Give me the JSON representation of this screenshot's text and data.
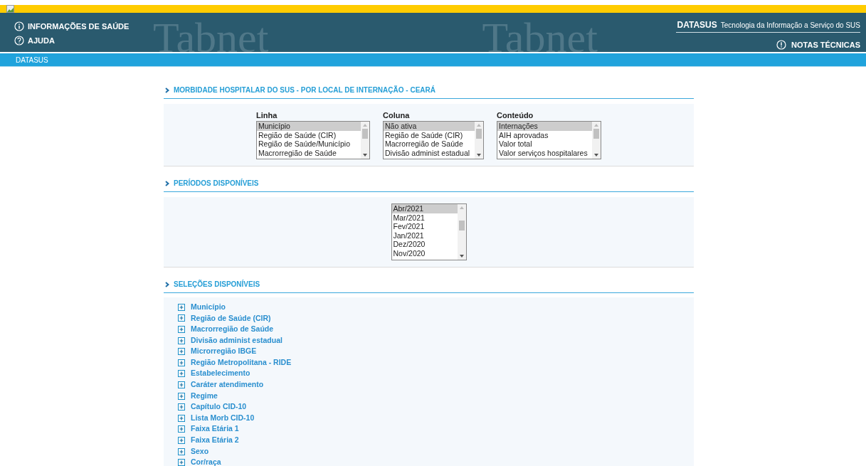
{
  "header": {
    "menu": [
      {
        "kind": "info",
        "label": "INFORMAÇÕES DE SAÚDE"
      },
      {
        "kind": "help",
        "label": "AJUDA"
      }
    ],
    "banner_words": [
      "Tabnet",
      "Tabnet"
    ],
    "brand": "DATASUS",
    "tagline": "Tecnologia da Informação a Serviço do SUS",
    "notes_link": "NOTAS TÉCNICAS"
  },
  "breadcrumb": "DATASUS",
  "sections": [
    {
      "title": "MORBIDADE HOSPITALAR DO SUS - POR LOCAL DE INTERNAÇÃO - CEARÁ",
      "kind": "lists",
      "lists": [
        {
          "label": "Linha",
          "options": [
            {
              "text": "Município",
              "selected": true
            },
            {
              "text": "Região de Saúde (CIR)",
              "selected": false
            },
            {
              "text": "Região de Saúde/Município",
              "selected": false
            },
            {
              "text": "Macrorregião de Saúde",
              "selected": false
            }
          ]
        },
        {
          "label": "Coluna",
          "options": [
            {
              "text": "Não ativa",
              "selected": true
            },
            {
              "text": "Região de Saúde (CIR)",
              "selected": false
            },
            {
              "text": "Macrorregião de Saúde",
              "selected": false
            },
            {
              "text": "Divisão administ estadual",
              "selected": false
            }
          ]
        },
        {
          "label": "Conteúdo",
          "options": [
            {
              "text": "Internações",
              "selected": true
            },
            {
              "text": "AIH aprovadas",
              "selected": false
            },
            {
              "text": "Valor total",
              "selected": false
            },
            {
              "text": "Valor serviços hospitalares",
              "selected": false
            }
          ]
        }
      ]
    },
    {
      "title": "PERÍODOS DISPONÍVEIS",
      "kind": "lists",
      "lists": [
        {
          "options": [
            {
              "text": "Abr/2021",
              "selected": true
            },
            {
              "text": "Mar/2021",
              "selected": false
            },
            {
              "text": "Fev/2021",
              "selected": false
            },
            {
              "text": "Jan/2021",
              "selected": false
            },
            {
              "text": "Dez/2020",
              "selected": false
            },
            {
              "text": "Nov/2020",
              "selected": false
            }
          ]
        }
      ]
    },
    {
      "title": "SELEÇÕES DISPONÍVEIS",
      "kind": "tree",
      "items": [
        {
          "label": "Município",
          "expanded": false
        },
        {
          "label": "Região de Saúde (CIR)",
          "expanded": false
        },
        {
          "label": "Macrorregião de Saúde",
          "expanded": false
        },
        {
          "label": "Divisão administ estadual",
          "expanded": false
        },
        {
          "label": "Microrregião IBGE",
          "expanded": false
        },
        {
          "label": "Região Metropolitana - RIDE",
          "expanded": false
        },
        {
          "label": "Estabelecimento",
          "expanded": false
        },
        {
          "label": "Caráter atendimento",
          "expanded": false
        },
        {
          "label": "Regime",
          "expanded": false
        },
        {
          "label": "Capítulo CID-10",
          "expanded": false
        },
        {
          "label": "Lista Morb CID-10",
          "expanded": false
        },
        {
          "label": "Faixa Etária 1",
          "expanded": false
        },
        {
          "label": "Faixa Etária 2",
          "expanded": false
        },
        {
          "label": "Sexo",
          "expanded": false
        },
        {
          "label": "Cor/raça",
          "expanded": false
        }
      ]
    }
  ]
}
